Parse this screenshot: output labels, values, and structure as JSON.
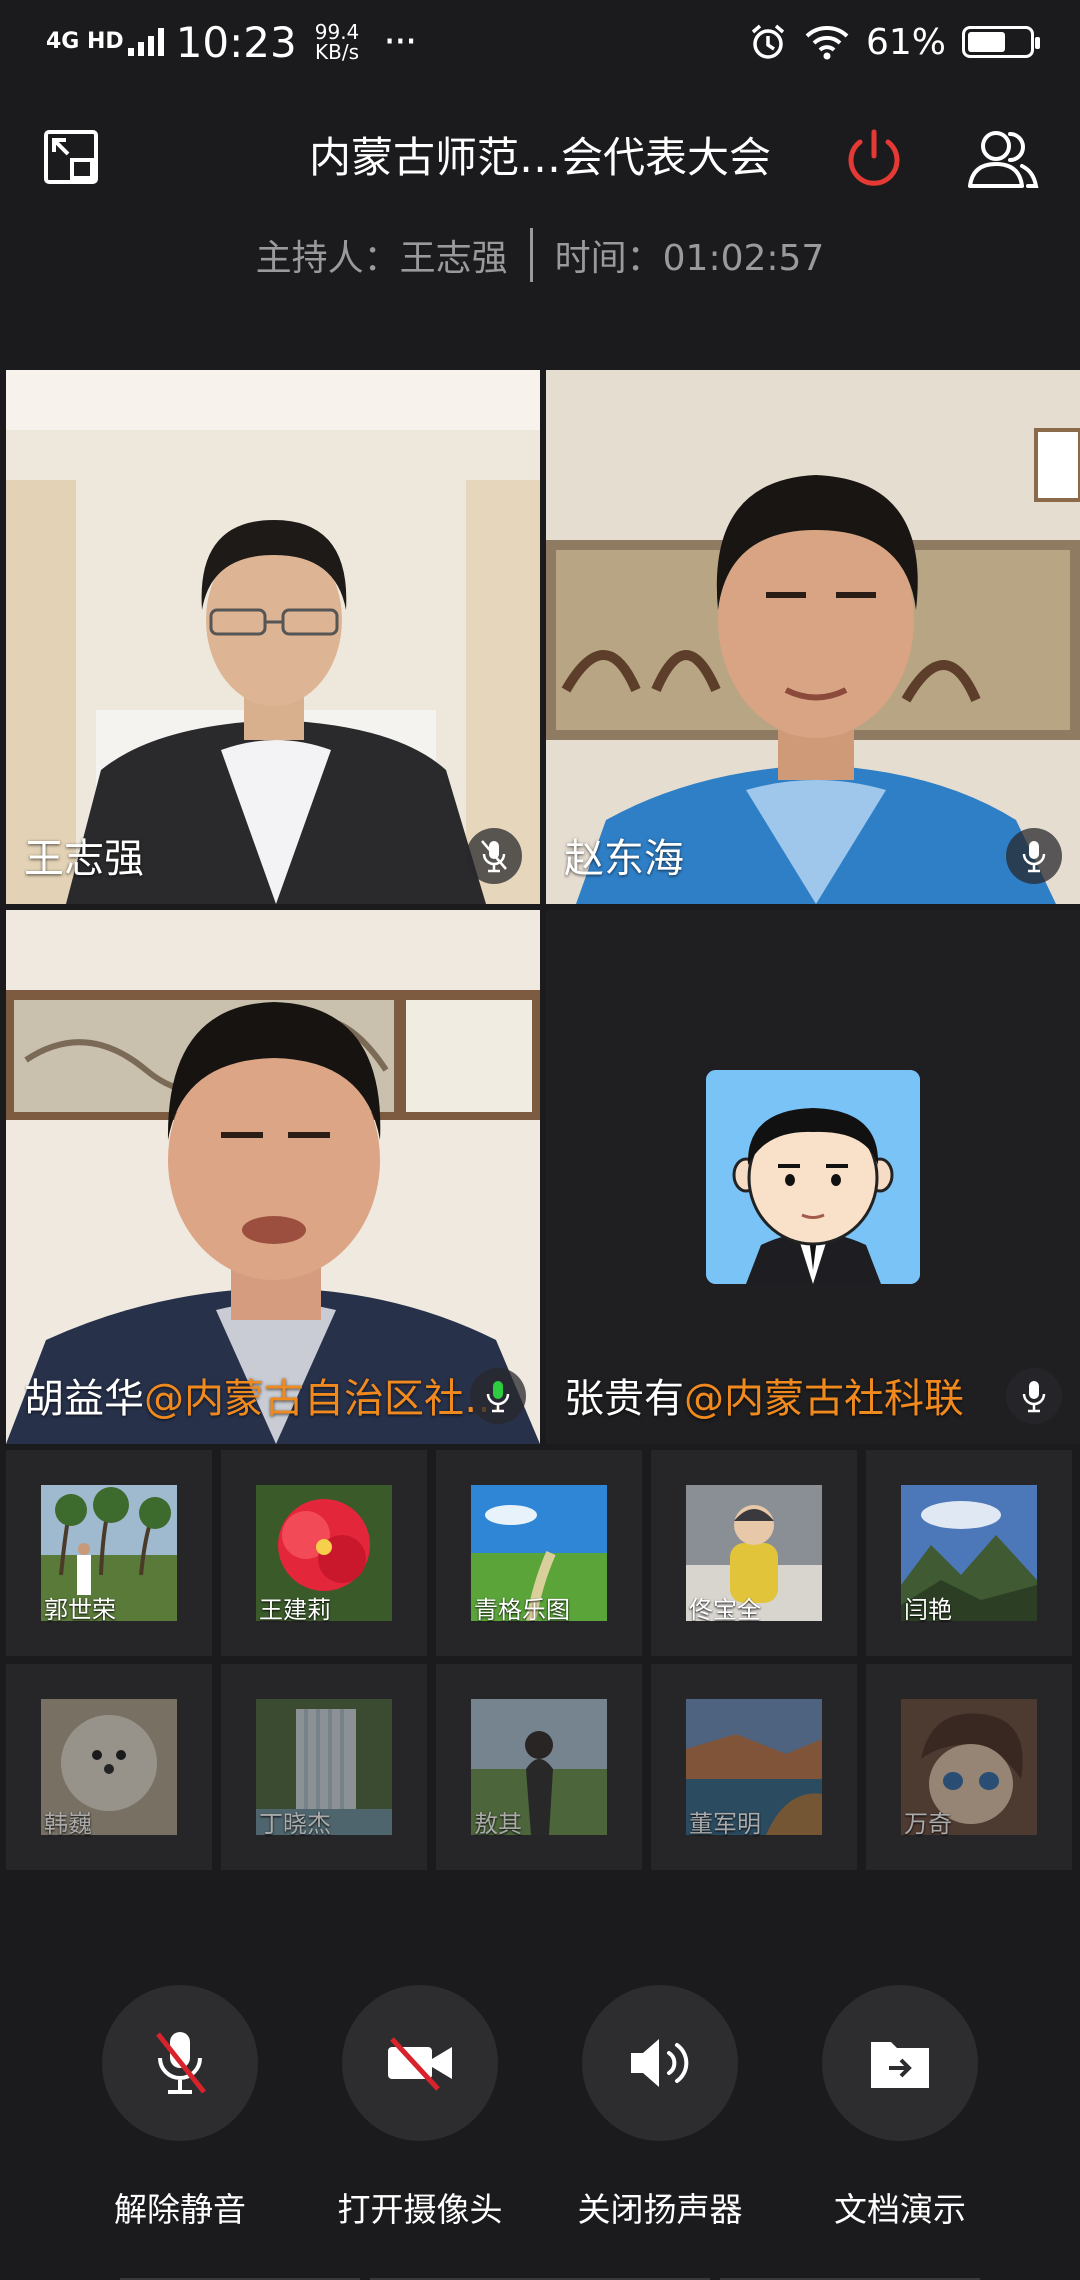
{
  "status_bar": {
    "network": "4G HD",
    "time": "10:23",
    "speed_value": "99.4",
    "speed_unit": "KB/s",
    "more": "···",
    "battery_percent": "61%",
    "battery_level": 0.61
  },
  "header": {
    "title": "内蒙古师范…会代表大会",
    "host_label": "主持人：王志强",
    "time_label": "时间：01:02:57"
  },
  "videos": [
    {
      "name": "王志强",
      "org": ""
    },
    {
      "name": "赵东海",
      "org": ""
    },
    {
      "name": "胡益华",
      "org": "@内蒙古自治区社…"
    },
    {
      "name": "张贵有",
      "org": "@内蒙古社科联"
    }
  ],
  "participants": [
    {
      "name": "郭世荣"
    },
    {
      "name": "王建莉"
    },
    {
      "name": "青格乐图"
    },
    {
      "name": "佟宝全"
    },
    {
      "name": "闫艳"
    },
    {
      "name": "韩巍"
    },
    {
      "name": "丁晓杰"
    },
    {
      "name": "敖其"
    },
    {
      "name": "董军明"
    },
    {
      "name": "万奇"
    }
  ],
  "controls": [
    {
      "label": "解除静音",
      "icon": "mic-muted-icon"
    },
    {
      "label": "打开摄像头",
      "icon": "camera-off-icon"
    },
    {
      "label": "关闭扬声器",
      "icon": "speaker-icon"
    },
    {
      "label": "文档演示",
      "icon": "share-document-icon"
    }
  ],
  "colors": {
    "background": "#1b1b1d",
    "org_accent": "#f08a1e",
    "power_red": "#e53935",
    "avatar_bg": "#7ac3f7"
  }
}
